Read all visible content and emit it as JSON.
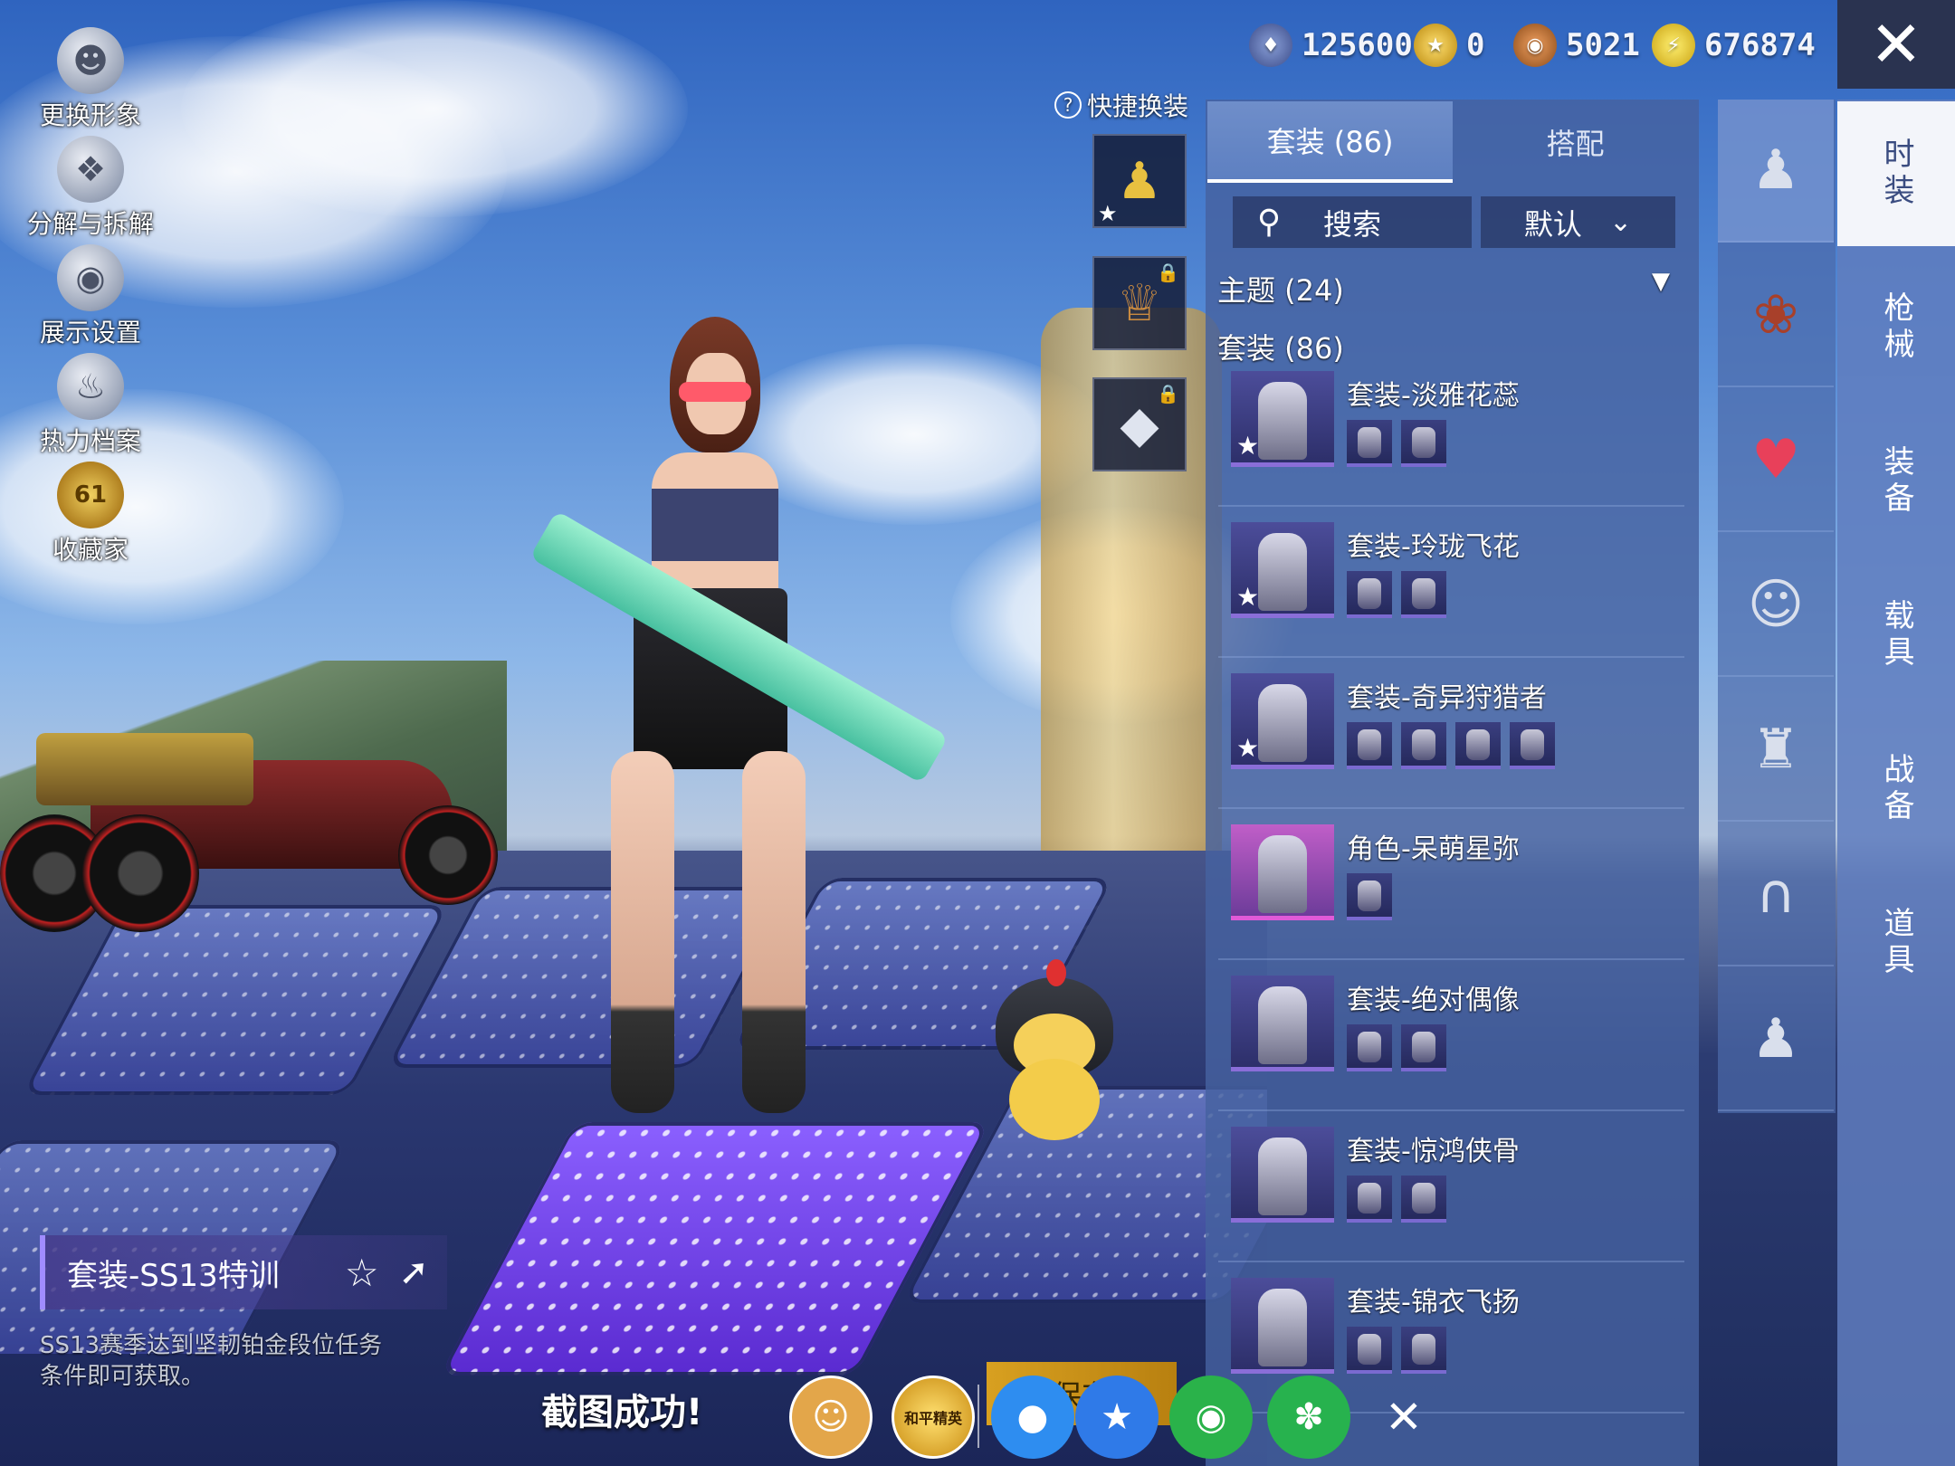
{
  "left_menu": [
    {
      "label": "更换形象",
      "icon": "avatar-icon"
    },
    {
      "label": "分解与拆解",
      "icon": "puzzle-icon"
    },
    {
      "label": "展示设置",
      "icon": "eye-icon"
    },
    {
      "label": "热力档案",
      "icon": "flame-icon"
    },
    {
      "label": "收藏家",
      "icon": "collector-badge-icon",
      "badge": "61"
    }
  ],
  "currencies": [
    {
      "icon": "coin-silver-icon",
      "value": "125600",
      "color": "#5a6ea8"
    },
    {
      "icon": "coin-gold-icon",
      "value": "0",
      "color": "#c79a2a"
    },
    {
      "icon": "coin-bronze-icon",
      "value": "5021",
      "color": "#b06a2a"
    },
    {
      "icon": "coin-lightning-icon",
      "value": "676874",
      "color": "#d4b018"
    }
  ],
  "quick_change": {
    "label": "快捷换装",
    "help_icon": "question-circle-icon"
  },
  "panel": {
    "tabs": [
      {
        "label": "套装 (86)",
        "active": true
      },
      {
        "label": "搭配",
        "active": false
      }
    ],
    "search_label": "搜索",
    "sort_label": "默认",
    "theme_section": "主题 (24)",
    "suit_section": "套装 (86)",
    "items": [
      {
        "name": "套装-淡雅花蕊",
        "star": true,
        "subs": 2,
        "rarity": "#8a6ed8"
      },
      {
        "name": "套装-玲珑飞花",
        "star": true,
        "subs": 2,
        "rarity": "#8a6ed8"
      },
      {
        "name": "套装-奇异狩猎者",
        "star": true,
        "subs": 4,
        "rarity": "#8a6ed8"
      },
      {
        "name": "角色-呆萌星弥",
        "star": false,
        "subs": 1,
        "rarity": "#e05ad8"
      },
      {
        "name": "套装-绝对偶像",
        "star": false,
        "subs": 2,
        "rarity": "#8a6ed8"
      },
      {
        "name": "套装-惊鸿侠骨",
        "star": false,
        "subs": 2,
        "rarity": "#8a6ed8"
      },
      {
        "name": "套装-锦衣飞扬",
        "star": false,
        "subs": 2,
        "rarity": "#8a6ed8"
      }
    ]
  },
  "categories": [
    "outfit-icon",
    "hair-icon",
    "glasses-icon",
    "mask-icon",
    "vest-icon",
    "pants-icon",
    "boots-icon"
  ],
  "right_tabs": [
    {
      "label": "时装",
      "active": true
    },
    {
      "label": "枪械",
      "active": false
    },
    {
      "label": "装备",
      "active": false
    },
    {
      "label": "载具",
      "active": false
    },
    {
      "label": "战备",
      "active": false
    },
    {
      "label": "道具",
      "active": false
    }
  ],
  "current_outfit": {
    "name": "套装-SS13特训",
    "description": "SS13赛季达到坚韧铂金段位任务条件即可获取。"
  },
  "share_bar": {
    "toast": "截图成功!",
    "save_label": "保存",
    "buttons": [
      {
        "icon": "profile-share-icon",
        "color": "#e3a64a"
      },
      {
        "icon": "game-logo-icon",
        "color": "#f0c23a",
        "text": "和平精英"
      },
      {
        "icon": "qq-icon",
        "color": "#2e8df0"
      },
      {
        "icon": "qzone-icon",
        "color": "#2f7ae8"
      },
      {
        "icon": "wechat-icon",
        "color": "#2ab24a"
      },
      {
        "icon": "moments-icon",
        "color": "#27b24e"
      }
    ]
  }
}
